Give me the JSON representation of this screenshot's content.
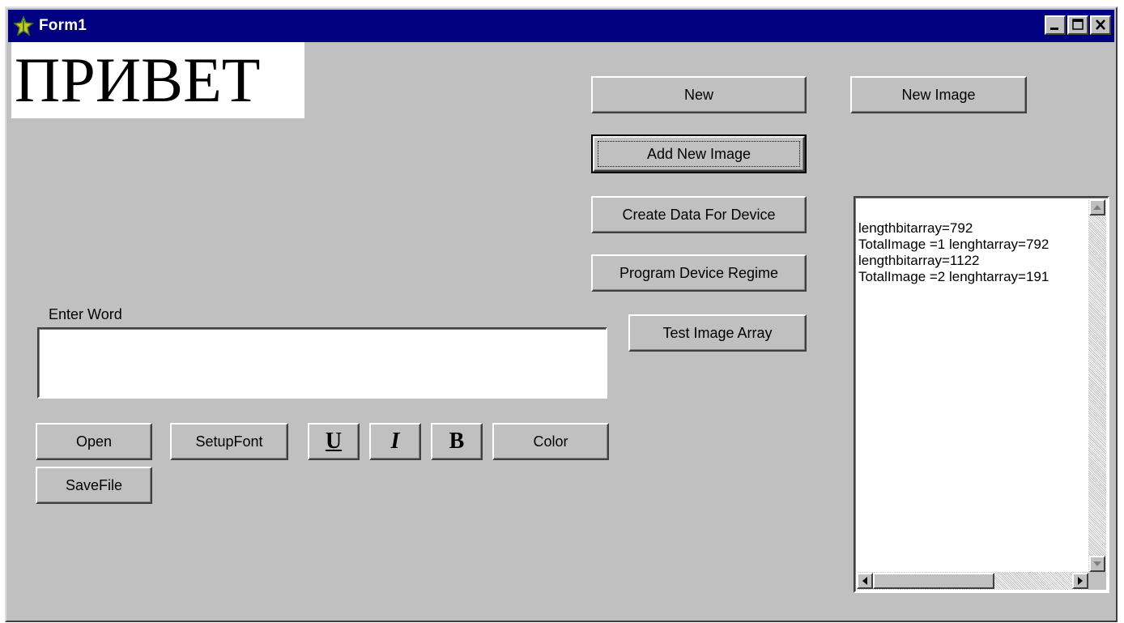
{
  "window": {
    "title": "Form1"
  },
  "greeting": "ПРИВЕТ",
  "buttons": {
    "new": "New",
    "new_image": "New Image",
    "add_new_image": "Add New Image",
    "create_data": "Create Data For Device",
    "program_device": "Program Device Regime",
    "test_image_array": "Test Image Array",
    "open": "Open",
    "setup_font": "SetupFont",
    "underline": "U",
    "italic": "I",
    "bold": "B",
    "color": "Color",
    "save_file": "SaveFile"
  },
  "enter_word": {
    "label": "Enter Word",
    "value": ""
  },
  "memo": {
    "lines": "lengthbitarray=792\nTotalImage =1 lenghtarray=792\nlengthbitarray=1122\nTotalImage =2 lenghtarray=191"
  },
  "colors": {
    "title_bar": "#000080",
    "face": "#c0c0c0",
    "field_bg": "#ffffff"
  }
}
